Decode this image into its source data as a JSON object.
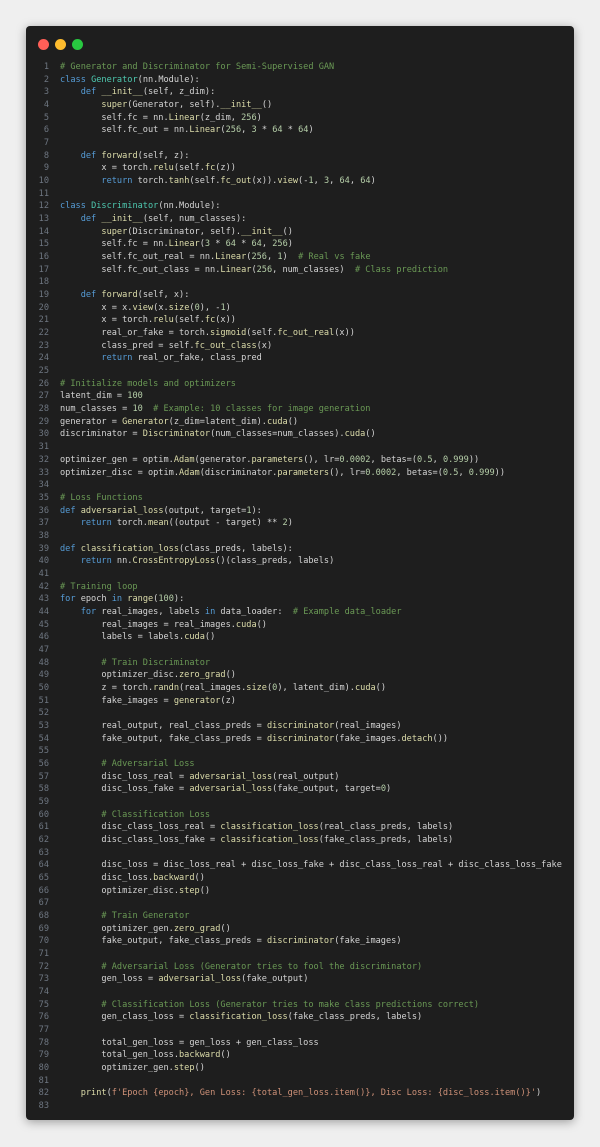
{
  "window": {
    "buttons": [
      {
        "name": "close",
        "color": "#ff5f57"
      },
      {
        "name": "minimize",
        "color": "#febc2e"
      },
      {
        "name": "maximize",
        "color": "#28c840"
      }
    ]
  },
  "code": {
    "language": "python",
    "lines": [
      "# Generator and Discriminator for Semi-Supervised GAN",
      "class Generator(nn.Module):",
      "    def __init__(self, z_dim):",
      "        super(Generator, self).__init__()",
      "        self.fc = nn.Linear(z_dim, 256)",
      "        self.fc_out = nn.Linear(256, 3 * 64 * 64)",
      "",
      "    def forward(self, z):",
      "        x = torch.relu(self.fc(z))",
      "        return torch.tanh(self.fc_out(x)).view(-1, 3, 64, 64)",
      "",
      "class Discriminator(nn.Module):",
      "    def __init__(self, num_classes):",
      "        super(Discriminator, self).__init__()",
      "        self.fc = nn.Linear(3 * 64 * 64, 256)",
      "        self.fc_out_real = nn.Linear(256, 1)  # Real vs fake",
      "        self.fc_out_class = nn.Linear(256, num_classes)  # Class prediction",
      "",
      "    def forward(self, x):",
      "        x = x.view(x.size(0), -1)",
      "        x = torch.relu(self.fc(x))",
      "        real_or_fake = torch.sigmoid(self.fc_out_real(x))",
      "        class_pred = self.fc_out_class(x)",
      "        return real_or_fake, class_pred",
      "",
      "# Initialize models and optimizers",
      "latent_dim = 100",
      "num_classes = 10  # Example: 10 classes for image generation",
      "generator = Generator(z_dim=latent_dim).cuda()",
      "discriminator = Discriminator(num_classes=num_classes).cuda()",
      "",
      "optimizer_gen = optim.Adam(generator.parameters(), lr=0.0002, betas=(0.5, 0.999))",
      "optimizer_disc = optim.Adam(discriminator.parameters(), lr=0.0002, betas=(0.5, 0.999))",
      "",
      "# Loss Functions",
      "def adversarial_loss(output, target=1):",
      "    return torch.mean((output - target) ** 2)",
      "",
      "def classification_loss(class_preds, labels):",
      "    return nn.CrossEntropyLoss()(class_preds, labels)",
      "",
      "# Training loop",
      "for epoch in range(100):",
      "    for real_images, labels in data_loader:  # Example data_loader",
      "        real_images = real_images.cuda()",
      "        labels = labels.cuda()",
      "",
      "        # Train Discriminator",
      "        optimizer_disc.zero_grad()",
      "        z = torch.randn(real_images.size(0), latent_dim).cuda()",
      "        fake_images = generator(z)",
      "",
      "        real_output, real_class_preds = discriminator(real_images)",
      "        fake_output, fake_class_preds = discriminator(fake_images.detach())",
      "",
      "        # Adversarial Loss",
      "        disc_loss_real = adversarial_loss(real_output)",
      "        disc_loss_fake = adversarial_loss(fake_output, target=0)",
      "",
      "        # Classification Loss",
      "        disc_class_loss_real = classification_loss(real_class_preds, labels)",
      "        disc_class_loss_fake = classification_loss(fake_class_preds, labels)",
      "",
      "        disc_loss = disc_loss_real + disc_loss_fake + disc_class_loss_real + disc_class_loss_fake",
      "        disc_loss.backward()",
      "        optimizer_disc.step()",
      "",
      "        # Train Generator",
      "        optimizer_gen.zero_grad()",
      "        fake_output, fake_class_preds = discriminator(fake_images)",
      "",
      "        # Adversarial Loss (Generator tries to fool the discriminator)",
      "        gen_loss = adversarial_loss(fake_output)",
      "",
      "        # Classification Loss (Generator tries to make class predictions correct)",
      "        gen_class_loss = classification_loss(fake_class_preds, labels)",
      "",
      "        total_gen_loss = gen_loss + gen_class_loss",
      "        total_gen_loss.backward()",
      "        optimizer_gen.step()",
      "",
      "    print(f'Epoch {epoch}, Gen Loss: {total_gen_loss.item()}, Disc Loss: {disc_loss.item()}')",
      ""
    ]
  }
}
